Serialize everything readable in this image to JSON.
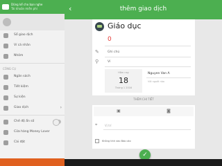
{
  "drawer": {
    "account_name": "Dũng kể cho bạn nghe",
    "account_status": "Tài khoản miễn phí",
    "sections": {
      "top_items": [
        {
          "label": "Sổ giao dịch",
          "icon": "ledger-icon"
        },
        {
          "label": "Ví cá nhân",
          "icon": "wallet-icon"
        },
        {
          "label": "Nhóm",
          "icon": "group-icon"
        }
      ],
      "tools_heading": "CÔNG CỤ",
      "tool_items": [
        {
          "label": "Ngân sách",
          "icon": "budget-icon"
        },
        {
          "label": "Tiết kiệm",
          "icon": "savings-icon"
        },
        {
          "label": "Sự kiện",
          "icon": "event-icon"
        },
        {
          "label": "Giao dịch",
          "icon": "recurring-icon"
        }
      ],
      "bottom_items": [
        {
          "label": "Chế độ ẩn số",
          "icon": "hide-number-icon"
        },
        {
          "label": "Cửa hàng Money Lover",
          "icon": "store-icon"
        },
        {
          "label": "Cài đặt",
          "icon": "settings-icon"
        }
      ]
    }
  },
  "topbar": {
    "title": "thêm giao dịch"
  },
  "form": {
    "category": "Giáo dục",
    "amount": "0",
    "note_placeholder": "Ghi chú",
    "wallet": "Ví",
    "date_label": "Hôm nay",
    "date_day": "18",
    "date_month": "Tháng 1 2016",
    "with_person": "Nguyen Van A",
    "with_hint": "Với người nào"
  },
  "more": {
    "label": "THÊM CHI TIẾT",
    "location_placeholder": "Vị trí",
    "exclude_label": "Không tính vào Báo cáo"
  },
  "colors": {
    "primary": "#4caf50",
    "amount": "#e53935",
    "accent_bottom": "#e0601f"
  }
}
